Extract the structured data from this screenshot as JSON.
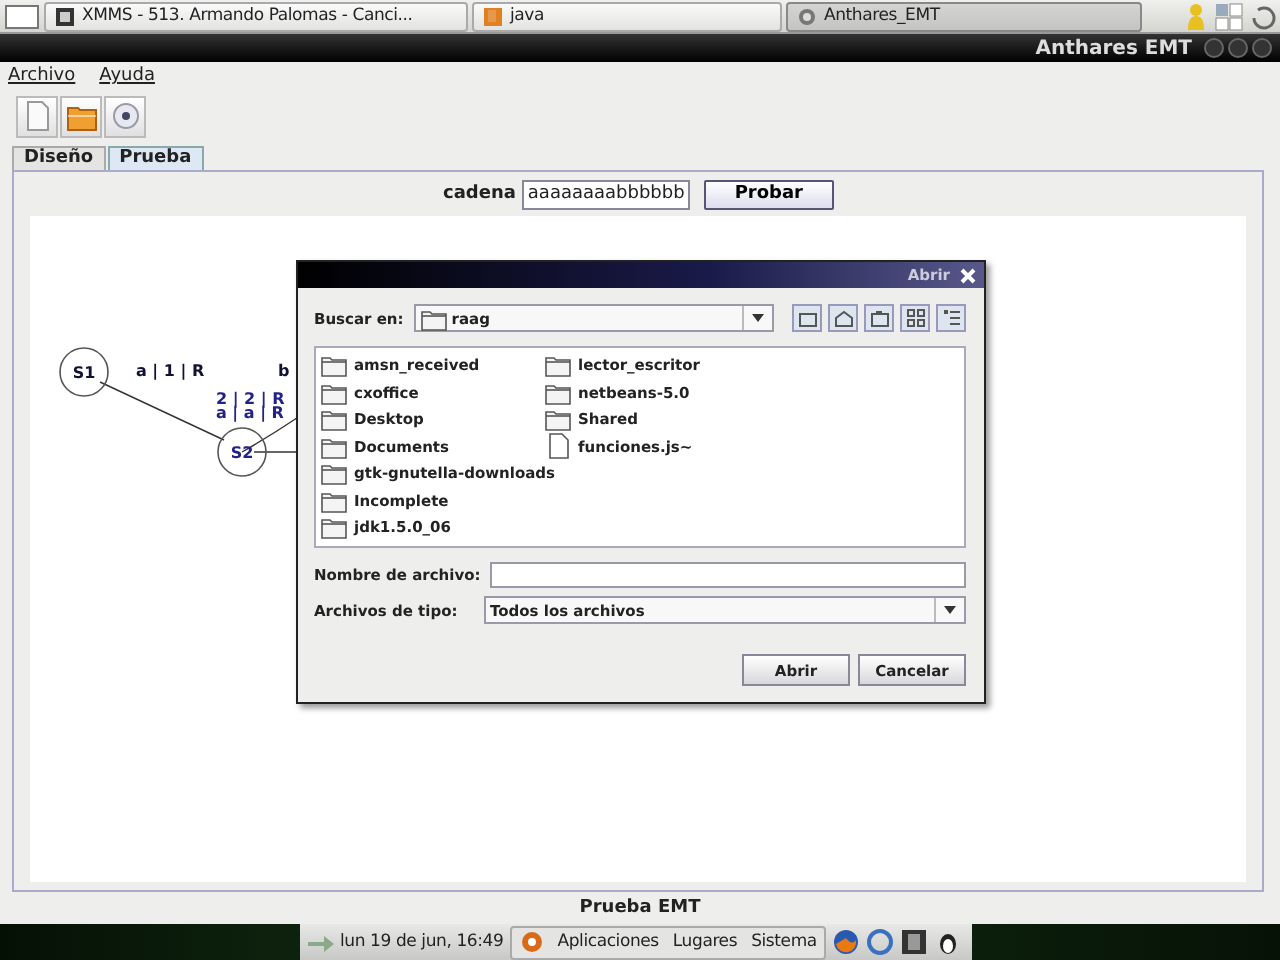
{
  "taskbar": {
    "tasks": [
      {
        "label": "XMMS - 513. Armando Palomas - Canci...",
        "selected": false
      },
      {
        "label": "java",
        "selected": false
      },
      {
        "label": "Anthares_EMT",
        "selected": true
      }
    ]
  },
  "window": {
    "title": "Anthares  EMT"
  },
  "menu": [
    "Archivo",
    "Ayuda"
  ],
  "tabs": [
    {
      "label": "Diseño",
      "selected": false
    },
    {
      "label": "Prueba",
      "selected": true
    }
  ],
  "test": {
    "label": "cadena",
    "value": "aaaaaaaabbbbbb",
    "button": "Probar"
  },
  "diagram": {
    "states": [
      "S1",
      "S2"
    ],
    "transitions": [
      "a | 1 | R",
      "2 | 2 | R",
      "a | a | R",
      "b"
    ]
  },
  "dialog": {
    "title": "Abrir",
    "look_in_label": "Buscar en:",
    "look_in_value": "raag",
    "files": [
      {
        "name": "amsn_received",
        "kind": "folder"
      },
      {
        "name": "cxoffice",
        "kind": "folder"
      },
      {
        "name": "Desktop",
        "kind": "folder"
      },
      {
        "name": "Documents",
        "kind": "folder"
      },
      {
        "name": "gtk-gnutella-downloads",
        "kind": "folder"
      },
      {
        "name": "Incomplete",
        "kind": "folder"
      },
      {
        "name": "jdk1.5.0_06",
        "kind": "folder"
      },
      {
        "name": "lector_escritor",
        "kind": "folder"
      },
      {
        "name": "netbeans-5.0",
        "kind": "folder"
      },
      {
        "name": "Shared",
        "kind": "folder"
      },
      {
        "name": "funciones.js~",
        "kind": "file"
      }
    ],
    "filename_label": "Nombre de archivo:",
    "filetype_label": "Archivos de tipo:",
    "filetype_value": "Todos los archivos",
    "buttons": [
      "Abrir",
      "Cancelar"
    ]
  },
  "status": "Prueba EMT",
  "panel": {
    "clock": "lun 19 de jun, 16:49",
    "menus": [
      "Aplicaciones",
      "Lugares",
      "Sistema"
    ]
  }
}
